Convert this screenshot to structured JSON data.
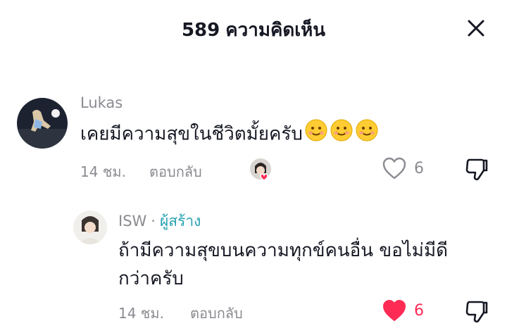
{
  "header": {
    "count": "589",
    "title_label": "ความคิดเห็น"
  },
  "comments": [
    {
      "username": "Lukas",
      "text": "เคยมีความสุขในชีวิตมั้ยครับ",
      "emojis": [
        "smiling-face-icon",
        "smiling-face-icon",
        "smiling-face-icon"
      ],
      "time": "14 ชม.",
      "reply_label": "ตอบกลับ",
      "likes": "6",
      "liked": false
    },
    {
      "username": "ISW",
      "creator_badge": "ผู้สร้าง",
      "text_line1": "ถ้ามีความสุขบนความทุกข์คนอื่น ขอไม่มีดี",
      "text_line2": "กว่าครับ",
      "time": "14 ชม.",
      "reply_label": "ตอบกลับ",
      "likes": "6",
      "liked": true
    }
  ],
  "colors": {
    "text": "#161823",
    "muted": "#8a8b91",
    "creator": "#27a2b0",
    "like_red": "#fe2c55"
  }
}
